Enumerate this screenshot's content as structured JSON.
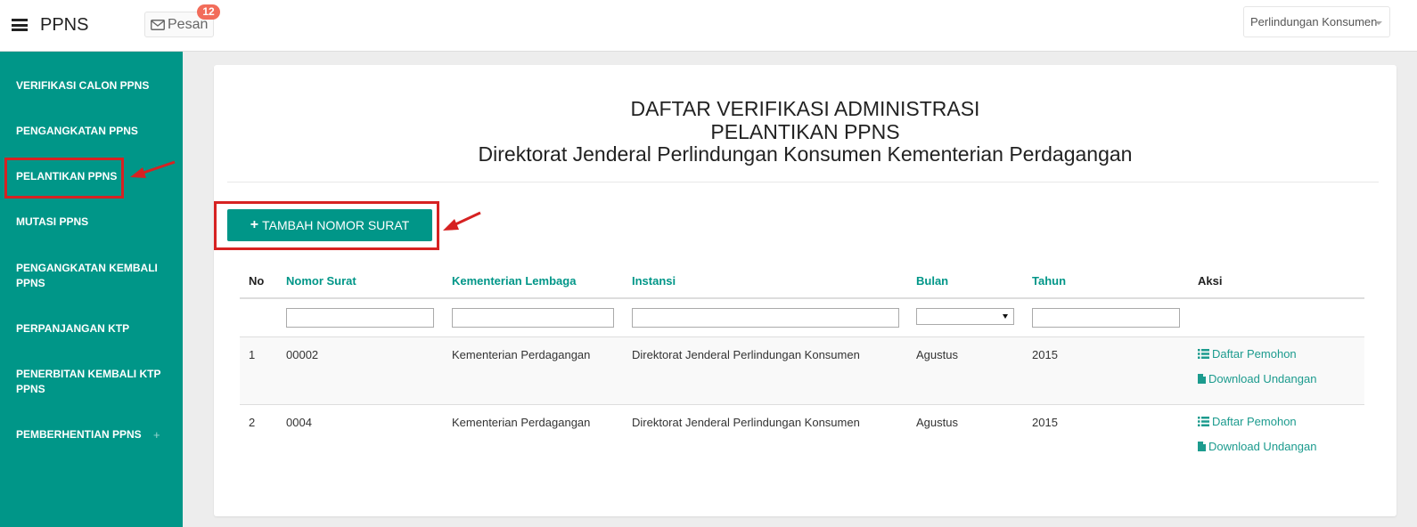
{
  "app": {
    "title": "PPNS"
  },
  "header": {
    "messages_label": "Pesan",
    "messages_count": "12",
    "ministry_selected": "Perlindungan Konsumen"
  },
  "sidebar": {
    "items": [
      {
        "label": "VERIFIKASI CALON PPNS"
      },
      {
        "label": "PENGANGKATAN PPNS"
      },
      {
        "label": "PELANTIKAN PPNS"
      },
      {
        "label": "MUTASI PPNS"
      },
      {
        "label": "PENGANGKATAN KEMBALI PPNS"
      },
      {
        "label": "PERPANJANGAN KTP"
      },
      {
        "label": "PENERBITAN KEMBALI KTP PPNS"
      },
      {
        "label": "PEMBERHENTIAN PPNS",
        "expand": "+"
      }
    ]
  },
  "page": {
    "title_line1": "DAFTAR VERIFIKASI ADMINISTRASI",
    "title_line2": "PELANTIKAN PPNS",
    "title_line3": "Direktorat Jenderal Perlindungan Konsumen Kementerian Perdagangan",
    "add_button": "TAMBAH NOMOR SURAT"
  },
  "table": {
    "columns": [
      "No",
      "Nomor Surat",
      "Kementerian Lembaga",
      "Instansi",
      "Bulan",
      "Tahun",
      "Aksi"
    ],
    "rows": [
      {
        "no": "1",
        "nomor_surat": "00002",
        "kementerian": "Kementerian Perdagangan",
        "instansi": "Direktorat Jenderal Perlindungan Konsumen",
        "bulan": "Agustus",
        "tahun": "2015",
        "action1": "Daftar Pemohon",
        "action2": "Download Undangan"
      },
      {
        "no": "2",
        "nomor_surat": "0004",
        "kementerian": "Kementerian Perdagangan",
        "instansi": "Direktorat Jenderal Perlindungan Konsumen",
        "bulan": "Agustus",
        "tahun": "2015",
        "action1": "Daftar Pemohon",
        "action2": "Download Undangan"
      }
    ]
  },
  "colors": {
    "accent": "#009688",
    "badge": "#f26c5a",
    "annotation": "#d62222"
  }
}
